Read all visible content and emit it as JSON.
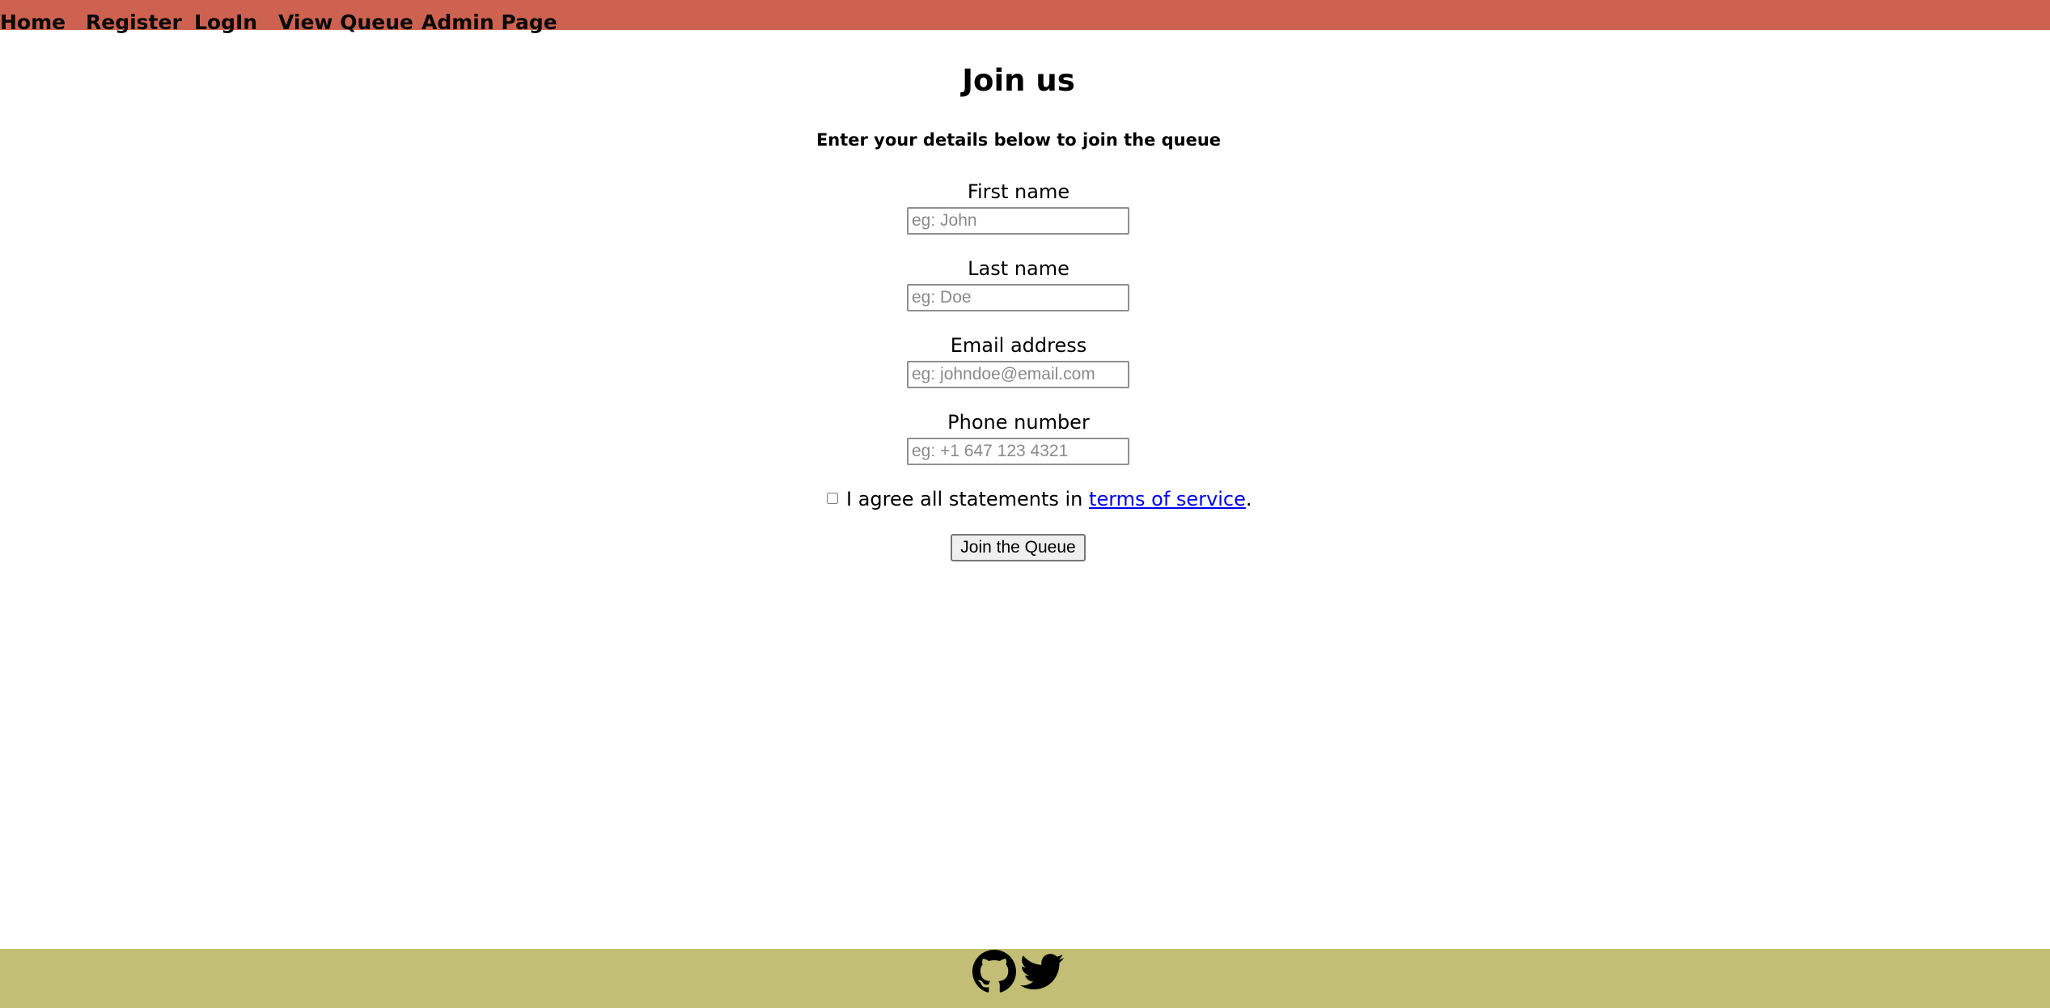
{
  "nav": {
    "items": [
      {
        "label": "Home"
      },
      {
        "label": "Register"
      },
      {
        "label": "LogIn"
      },
      {
        "label": "View Queue"
      },
      {
        "label": "Admin Page"
      }
    ]
  },
  "form": {
    "title": "Join us",
    "subtitle": "Enter your details below to join the queue",
    "first_name": {
      "label": "First name",
      "placeholder": "eg: John",
      "value": ""
    },
    "last_name": {
      "label": "Last name",
      "placeholder": "eg: Doe",
      "value": ""
    },
    "email": {
      "label": "Email address",
      "placeholder": "eg: johndoe@email.com",
      "value": ""
    },
    "phone": {
      "label": "Phone number",
      "placeholder": "eg: +1 647 123 4321",
      "value": ""
    },
    "terms": {
      "prefix": "I agree all statements in ",
      "link_text": "terms of service",
      "suffix": ".",
      "checked": false
    },
    "submit_label": "Join the Queue"
  },
  "footer": {
    "icons": [
      "github-icon",
      "twitter-icon"
    ]
  },
  "colors": {
    "navbar": "#cd6250",
    "footer": "#c2be75",
    "link": "#0000ee"
  }
}
